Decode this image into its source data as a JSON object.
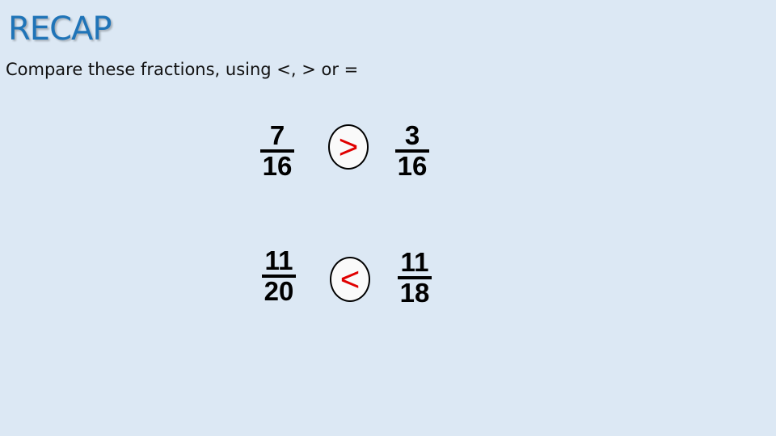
{
  "slide": {
    "title": "RECAP",
    "instruction": "Compare these fractions, using <, >  or ="
  },
  "comparisons": [
    {
      "left": {
        "numerator": "7",
        "denominator": "16"
      },
      "symbol": ">",
      "right": {
        "numerator": "3",
        "denominator": "16"
      }
    },
    {
      "left": {
        "numerator": "11",
        "denominator": "20"
      },
      "symbol": "<",
      "right": {
        "numerator": "11",
        "denominator": "18"
      }
    }
  ],
  "colors": {
    "title": "#1f74b8",
    "symbol": "#e00000",
    "background": "#dce8f4"
  }
}
